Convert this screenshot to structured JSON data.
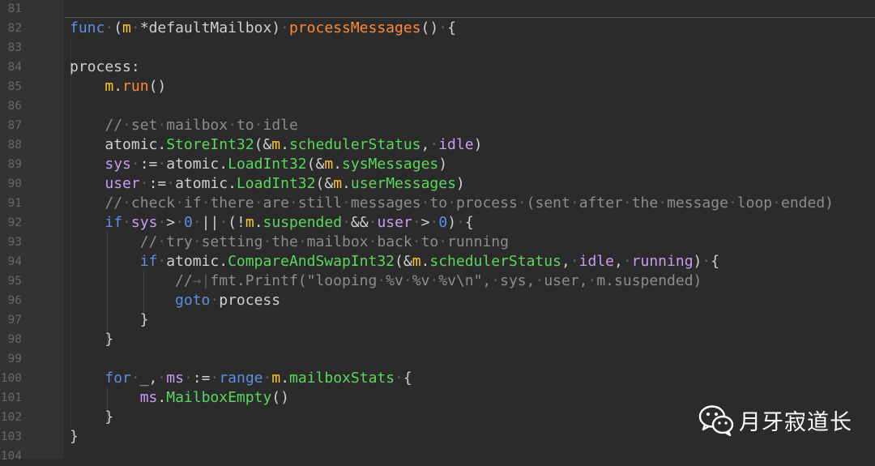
{
  "editor": {
    "line_numbers": [
      "81",
      "82",
      "83",
      "84",
      "85",
      "86",
      "87",
      "88",
      "89",
      "90",
      "91",
      "92",
      "93",
      "94",
      "95",
      "96",
      "97",
      "98",
      "99",
      "100",
      "101",
      "102",
      "103",
      "104"
    ],
    "lines": [
      [],
      [
        [
          "kw",
          "func"
        ],
        [
          "ws",
          "·"
        ],
        [
          "pl",
          "("
        ],
        [
          "rc",
          "m"
        ],
        [
          "ws",
          "·"
        ],
        [
          "pl",
          "*defaultMailbox)"
        ],
        [
          "ws",
          "·"
        ],
        [
          "fn",
          "processMessages"
        ],
        [
          "pl",
          "()"
        ],
        [
          "ws",
          "·"
        ],
        [
          "pl",
          "{"
        ]
      ],
      [],
      [
        [
          "lb",
          "process:"
        ]
      ],
      [
        [
          "pl",
          "    "
        ],
        [
          "rc",
          "m"
        ],
        [
          "pl",
          "."
        ],
        [
          "fn",
          "run"
        ],
        [
          "pl",
          "()"
        ]
      ],
      [],
      [
        [
          "pl",
          "    "
        ],
        [
          "cm",
          "//"
        ],
        [
          "ws",
          "·"
        ],
        [
          "cm",
          "set"
        ],
        [
          "ws",
          "·"
        ],
        [
          "cm",
          "mailbox"
        ],
        [
          "ws",
          "·"
        ],
        [
          "cm",
          "to"
        ],
        [
          "ws",
          "·"
        ],
        [
          "cm",
          "idle"
        ]
      ],
      [
        [
          "pl",
          "    atomic."
        ],
        [
          "pr",
          "StoreInt32"
        ],
        [
          "pl",
          "(&"
        ],
        [
          "rc",
          "m"
        ],
        [
          "pl",
          "."
        ],
        [
          "pr",
          "schedulerStatus"
        ],
        [
          "pl",
          ","
        ],
        [
          "ws",
          "·"
        ],
        [
          "id",
          "idle"
        ],
        [
          "pl",
          ")"
        ]
      ],
      [
        [
          "pl",
          "    "
        ],
        [
          "id",
          "sys"
        ],
        [
          "ws",
          "·"
        ],
        [
          "pl",
          ":="
        ],
        [
          "ws",
          "·"
        ],
        [
          "pl",
          "atomic."
        ],
        [
          "pr",
          "LoadInt32"
        ],
        [
          "pl",
          "(&"
        ],
        [
          "rc",
          "m"
        ],
        [
          "pl",
          "."
        ],
        [
          "pr",
          "sysMessages"
        ],
        [
          "pl",
          ")"
        ]
      ],
      [
        [
          "pl",
          "    "
        ],
        [
          "id",
          "user"
        ],
        [
          "ws",
          "·"
        ],
        [
          "pl",
          ":="
        ],
        [
          "ws",
          "·"
        ],
        [
          "pl",
          "atomic."
        ],
        [
          "pr",
          "LoadInt32"
        ],
        [
          "pl",
          "(&"
        ],
        [
          "rc",
          "m"
        ],
        [
          "pl",
          "."
        ],
        [
          "pr",
          "userMessages"
        ],
        [
          "pl",
          ")"
        ]
      ],
      [
        [
          "pl",
          "    "
        ],
        [
          "cm",
          "//"
        ],
        [
          "ws",
          "·"
        ],
        [
          "cm",
          "check"
        ],
        [
          "ws",
          "·"
        ],
        [
          "cm",
          "if"
        ],
        [
          "ws",
          "·"
        ],
        [
          "cm",
          "there"
        ],
        [
          "ws",
          "·"
        ],
        [
          "cm",
          "are"
        ],
        [
          "ws",
          "·"
        ],
        [
          "cm",
          "still"
        ],
        [
          "ws",
          "·"
        ],
        [
          "cm",
          "messages"
        ],
        [
          "ws",
          "·"
        ],
        [
          "cm",
          "to"
        ],
        [
          "ws",
          "·"
        ],
        [
          "cm",
          "process"
        ],
        [
          "ws",
          "·"
        ],
        [
          "cm",
          "(sent"
        ],
        [
          "ws",
          "·"
        ],
        [
          "cm",
          "after"
        ],
        [
          "ws",
          "·"
        ],
        [
          "cm",
          "the"
        ],
        [
          "ws",
          "·"
        ],
        [
          "cm",
          "message"
        ],
        [
          "ws",
          "·"
        ],
        [
          "cm",
          "loop"
        ],
        [
          "ws",
          "·"
        ],
        [
          "cm",
          "ended)"
        ]
      ],
      [
        [
          "pl",
          "    "
        ],
        [
          "kw",
          "if"
        ],
        [
          "ws",
          "·"
        ],
        [
          "id",
          "sys"
        ],
        [
          "ws",
          "·"
        ],
        [
          "pl",
          ">"
        ],
        [
          "ws",
          "·"
        ],
        [
          "nm",
          "0"
        ],
        [
          "ws",
          "·"
        ],
        [
          "pl",
          "||"
        ],
        [
          "ws",
          "·"
        ],
        [
          "pl",
          "(!"
        ],
        [
          "rc",
          "m"
        ],
        [
          "pl",
          "."
        ],
        [
          "pr",
          "suspended"
        ],
        [
          "ws",
          "·"
        ],
        [
          "pl",
          "&&"
        ],
        [
          "ws",
          "·"
        ],
        [
          "id",
          "user"
        ],
        [
          "ws",
          "·"
        ],
        [
          "pl",
          ">"
        ],
        [
          "ws",
          "·"
        ],
        [
          "nm",
          "0"
        ],
        [
          "pl",
          ")"
        ],
        [
          "ws",
          "·"
        ],
        [
          "pl",
          "{"
        ]
      ],
      [
        [
          "pl",
          "        "
        ],
        [
          "cm",
          "//"
        ],
        [
          "ws",
          "·"
        ],
        [
          "cm",
          "try"
        ],
        [
          "ws",
          "·"
        ],
        [
          "cm",
          "setting"
        ],
        [
          "ws",
          "·"
        ],
        [
          "cm",
          "the"
        ],
        [
          "ws",
          "·"
        ],
        [
          "cm",
          "mailbox"
        ],
        [
          "ws",
          "·"
        ],
        [
          "cm",
          "back"
        ],
        [
          "ws",
          "·"
        ],
        [
          "cm",
          "to"
        ],
        [
          "ws",
          "·"
        ],
        [
          "cm",
          "running"
        ]
      ],
      [
        [
          "pl",
          "        "
        ],
        [
          "kw",
          "if"
        ],
        [
          "ws",
          "·"
        ],
        [
          "pl",
          "atomic."
        ],
        [
          "pr",
          "CompareAndSwapInt32"
        ],
        [
          "pl",
          "(&"
        ],
        [
          "rc",
          "m"
        ],
        [
          "pl",
          "."
        ],
        [
          "pr",
          "schedulerStatus"
        ],
        [
          "pl",
          ","
        ],
        [
          "ws",
          "·"
        ],
        [
          "id",
          "idle"
        ],
        [
          "pl",
          ","
        ],
        [
          "ws",
          "·"
        ],
        [
          "id",
          "running"
        ],
        [
          "pl",
          ")"
        ],
        [
          "ws",
          "·"
        ],
        [
          "pl",
          "{"
        ]
      ],
      [
        [
          "pl",
          "            "
        ],
        [
          "cm",
          "//"
        ],
        [
          "ws",
          "→|"
        ],
        [
          "cm",
          "fmt.Printf(\"looping"
        ],
        [
          "ws",
          "·"
        ],
        [
          "cm",
          "%v"
        ],
        [
          "ws",
          "·"
        ],
        [
          "cm",
          "%v"
        ],
        [
          "ws",
          "·"
        ],
        [
          "cm",
          "%v\\n\","
        ],
        [
          "ws",
          "·"
        ],
        [
          "cm",
          "sys,"
        ],
        [
          "ws",
          "·"
        ],
        [
          "cm",
          "user,"
        ],
        [
          "ws",
          "·"
        ],
        [
          "cm",
          "m.suspended)"
        ]
      ],
      [
        [
          "pl",
          "            "
        ],
        [
          "kw",
          "goto"
        ],
        [
          "ws",
          "·"
        ],
        [
          "lb",
          "process"
        ]
      ],
      [
        [
          "pl",
          "        }"
        ]
      ],
      [
        [
          "pl",
          "    }"
        ]
      ],
      [],
      [
        [
          "pl",
          "    "
        ],
        [
          "kw",
          "for"
        ],
        [
          "ws",
          "·"
        ],
        [
          "pl",
          "_,"
        ],
        [
          "ws",
          "·"
        ],
        [
          "id",
          "ms"
        ],
        [
          "ws",
          "·"
        ],
        [
          "pl",
          ":="
        ],
        [
          "ws",
          "·"
        ],
        [
          "kw",
          "range"
        ],
        [
          "ws",
          "·"
        ],
        [
          "rc",
          "m"
        ],
        [
          "pl",
          "."
        ],
        [
          "pr",
          "mailboxStats"
        ],
        [
          "ws",
          "·"
        ],
        [
          "pl",
          "{"
        ]
      ],
      [
        [
          "pl",
          "        "
        ],
        [
          "id",
          "ms"
        ],
        [
          "pl",
          "."
        ],
        [
          "pr",
          "MailboxEmpty"
        ],
        [
          "pl",
          "()"
        ]
      ],
      [
        [
          "pl",
          "    }"
        ]
      ],
      [
        [
          "pl",
          "}"
        ]
      ],
      []
    ]
  },
  "watermark": {
    "icon": "wechat-icon",
    "text": "月牙寂道长"
  }
}
